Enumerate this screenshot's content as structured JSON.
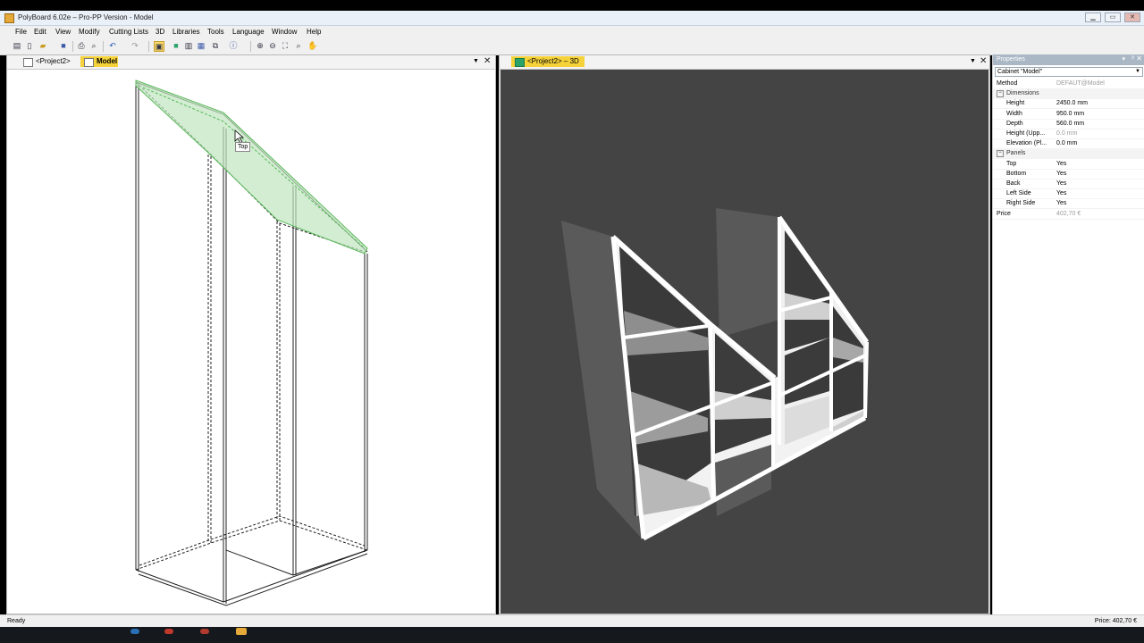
{
  "window": {
    "title": "PolyBoard 6.02e – Pro-PP Version - Model"
  },
  "menu": [
    "File",
    "Edit",
    "View",
    "Modify",
    "Cutting Lists",
    "3D",
    "Libraries",
    "Tools",
    "Language",
    "Window",
    "Help"
  ],
  "left_tabs": {
    "project": "<Project2>",
    "model": "Model"
  },
  "right_tabs": {
    "project3d": "<Project2> – 3D"
  },
  "tooltip": "Top",
  "properties": {
    "header": "Properties",
    "selector": "Cabinet \"Model\"",
    "rows": [
      {
        "type": "prop",
        "name": "Method",
        "value": "DEFAUT@Model",
        "gray": true,
        "indent": false
      },
      {
        "type": "group",
        "name": "Dimensions"
      },
      {
        "type": "prop",
        "name": "Height",
        "value": "2450.0 mm",
        "gray": false,
        "indent": true
      },
      {
        "type": "prop",
        "name": "Width",
        "value": "950.0 mm",
        "gray": false,
        "indent": true
      },
      {
        "type": "prop",
        "name": "Depth",
        "value": "560.0 mm",
        "gray": false,
        "indent": true
      },
      {
        "type": "prop",
        "name": "Height (Upp...",
        "value": "0.0 mm",
        "gray": true,
        "indent": true
      },
      {
        "type": "prop",
        "name": "Elevation (Pl...",
        "value": "0.0 mm",
        "gray": false,
        "indent": true
      },
      {
        "type": "group",
        "name": "Panels"
      },
      {
        "type": "prop",
        "name": "Top",
        "value": "Yes",
        "gray": false,
        "indent": true
      },
      {
        "type": "prop",
        "name": "Bottom",
        "value": "Yes",
        "gray": false,
        "indent": true
      },
      {
        "type": "prop",
        "name": "Back",
        "value": "Yes",
        "gray": false,
        "indent": true
      },
      {
        "type": "prop",
        "name": "Left Side",
        "value": "Yes",
        "gray": false,
        "indent": true
      },
      {
        "type": "prop",
        "name": "Right Side",
        "value": "Yes",
        "gray": false,
        "indent": true
      },
      {
        "type": "prop",
        "name": "Price",
        "value": "402,70 €",
        "gray": true,
        "indent": false
      }
    ]
  },
  "status": {
    "left": "Ready",
    "right": "Price: 402,70 €"
  },
  "colors": {
    "accent_tab": "#f5d23a",
    "render_bg": "#444444",
    "selection_green": "#8fd08f"
  }
}
